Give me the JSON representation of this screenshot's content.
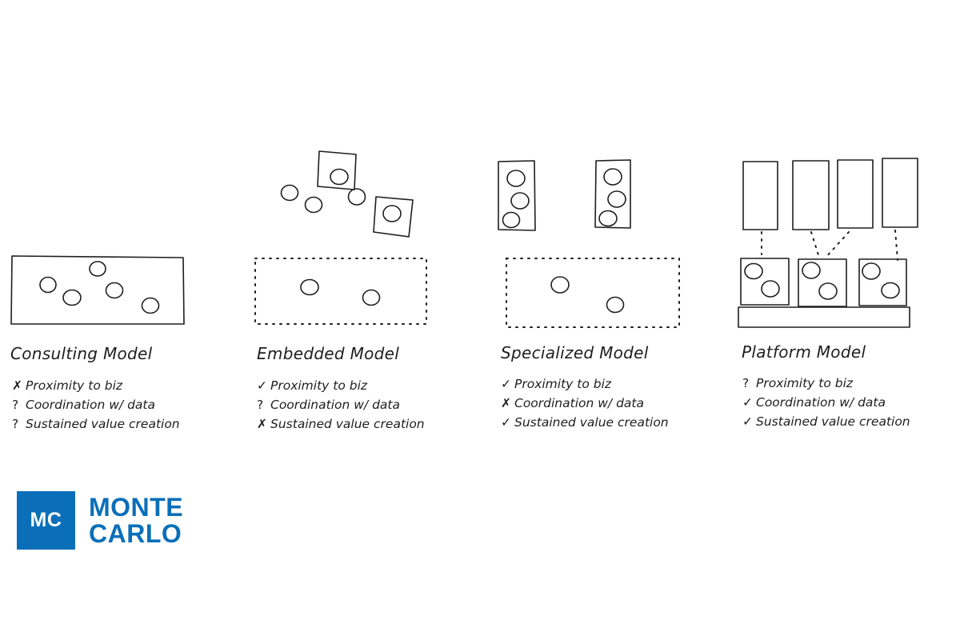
{
  "models": [
    {
      "id": "consulting",
      "title": "Consulting Model",
      "criteria": [
        {
          "mark": "✗",
          "status": "no",
          "label": "Proximity to biz"
        },
        {
          "mark": "?",
          "status": "unknown",
          "label": "Coordination w/ data"
        },
        {
          "mark": "?",
          "status": "unknown",
          "label": "Sustained value creation"
        }
      ]
    },
    {
      "id": "embedded",
      "title": "Embedded Model",
      "criteria": [
        {
          "mark": "✓",
          "status": "yes",
          "label": "Proximity to biz"
        },
        {
          "mark": "?",
          "status": "unknown",
          "label": "Coordination w/ data"
        },
        {
          "mark": "✗",
          "status": "no",
          "label": "Sustained value creation"
        }
      ]
    },
    {
      "id": "specialized",
      "title": "Specialized Model",
      "criteria": [
        {
          "mark": "✓",
          "status": "yes",
          "label": "Proximity to biz"
        },
        {
          "mark": "✗",
          "status": "no",
          "label": "Coordination w/ data"
        },
        {
          "mark": "✓",
          "status": "yes",
          "label": "Sustained value creation"
        }
      ]
    },
    {
      "id": "platform",
      "title": "Platform Model",
      "criteria": [
        {
          "mark": "?",
          "status": "unknown",
          "label": "Proximity to biz"
        },
        {
          "mark": "✓",
          "status": "yes",
          "label": "Coordination w/ data"
        },
        {
          "mark": "✓",
          "status": "yes",
          "label": "Sustained value creation"
        }
      ]
    }
  ],
  "logo": {
    "monogram": "MC",
    "line1": "MONTE",
    "line2": "CARLO",
    "color": "#0a6fb8"
  }
}
